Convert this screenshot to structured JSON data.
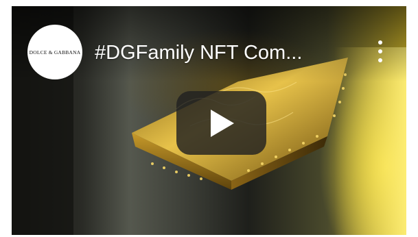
{
  "video": {
    "title": "#DGFamily NFT Com...",
    "channel_logo_text": "DOLCE & GABBANA"
  },
  "icons": {
    "menu": "more-vert-icon",
    "play": "play-icon"
  },
  "colors": {
    "play_button_bg": "#212121",
    "title_text": "#ffffff",
    "logo_bg": "#ffffff",
    "gold_accent": "#d4b436"
  }
}
